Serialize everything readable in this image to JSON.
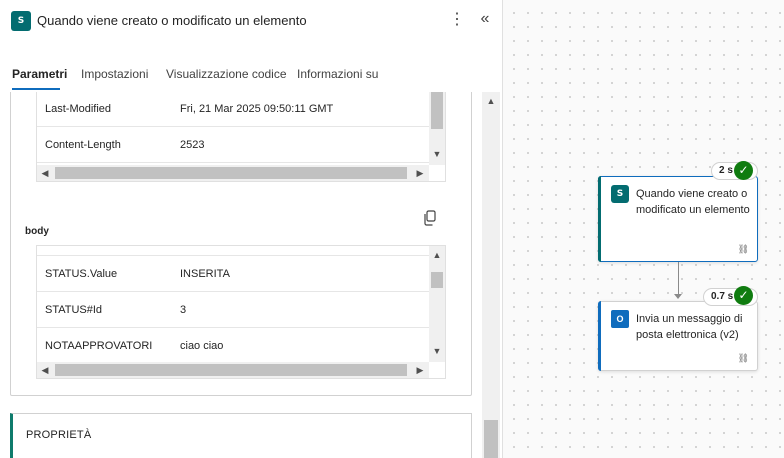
{
  "panel": {
    "title": "Quando viene creato o modificato un elemento",
    "icon": "sharepoint-icon",
    "icon_text": "S",
    "more_icon": "more-vertical-icon",
    "collapse_icon": "double-chevron-left-icon",
    "tabs": [
      {
        "label": "Parametri",
        "active": true
      },
      {
        "label": "Impostazioni",
        "active": false
      },
      {
        "label": "Visualizzazione codice",
        "active": false
      },
      {
        "label": "Informazioni su",
        "active": false
      }
    ]
  },
  "headers_table": {
    "rows": [
      {
        "key": "Last-Modified",
        "value": "Fri, 21 Mar 2025 09:50:11 GMT"
      },
      {
        "key": "Content-Length",
        "value": "2523"
      }
    ]
  },
  "body_section": {
    "label": "body",
    "copy_icon": "copy-icon",
    "rows": [
      {
        "key": "STATUS.Value",
        "value": "INSERITA"
      },
      {
        "key": "STATUS#Id",
        "value": "3"
      },
      {
        "key": "NOTAAPPROVATORI",
        "value": "ciao ciao"
      }
    ]
  },
  "properties_section": {
    "title": "PROPRIETÀ"
  },
  "flow": {
    "nodes": [
      {
        "label": "Quando viene creato o modificato un elemento",
        "duration": "2 s",
        "status": "success",
        "icon": "sharepoint-icon",
        "icon_text": "S",
        "link_icon": "link-icon"
      },
      {
        "label": "Invia un messaggio di posta elettronica (v2)",
        "duration": "0.7 s",
        "status": "success",
        "icon": "outlook-icon",
        "icon_text": "O",
        "link_icon": "link-icon"
      }
    ],
    "check_glyph": "✓"
  },
  "colors": {
    "accent": "#0f6cbd",
    "sharepoint": "#036c70",
    "success": "#107c10"
  }
}
